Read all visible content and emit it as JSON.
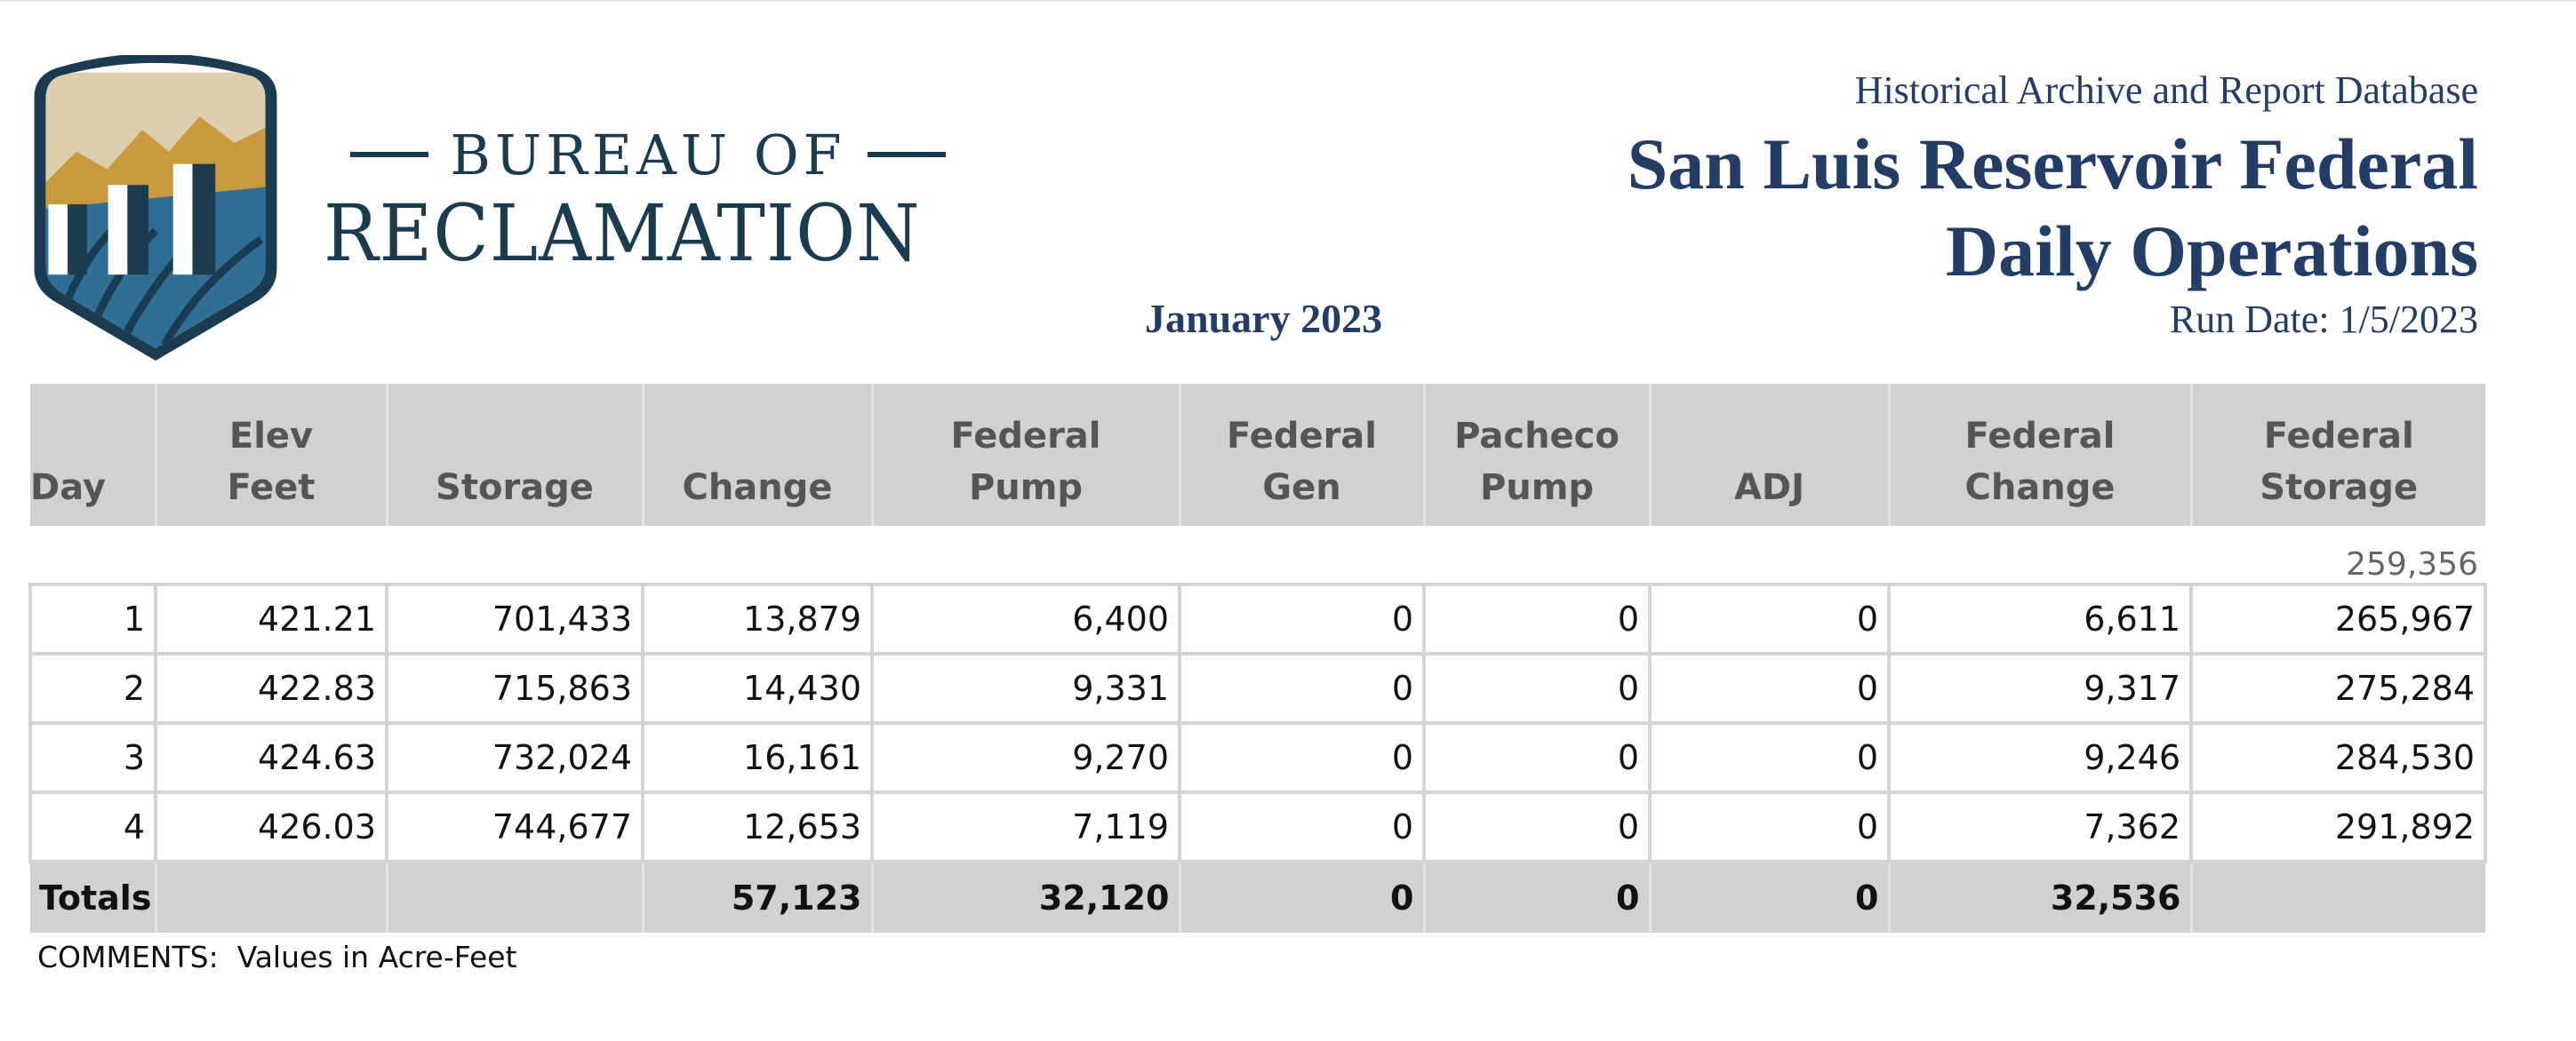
{
  "header": {
    "agency_line1": "BUREAU OF",
    "agency_line2": "RECLAMATION",
    "report_database": "Historical Archive and Report Database",
    "report_title": "San Luis Reservoir Federal\nDaily Operations",
    "run_date": "Run Date: 1/5/2023",
    "period": "January 2023"
  },
  "logo": {
    "icon": "reclamation-shield-icon",
    "colors": {
      "border": "#1b3b50",
      "sky": "#ddcfae",
      "mountains": "#c99a3d",
      "water": "#2f6f96",
      "pillars": "#1b3b50"
    }
  },
  "table": {
    "columns": [
      {
        "line1": "",
        "line2": "Day"
      },
      {
        "line1": "Elev",
        "line2": "Feet"
      },
      {
        "line1": "",
        "line2": "Storage"
      },
      {
        "line1": "",
        "line2": "Change"
      },
      {
        "line1": "Federal",
        "line2": "Pump"
      },
      {
        "line1": "Federal",
        "line2": "Gen"
      },
      {
        "line1": "Pacheco",
        "line2": "Pump"
      },
      {
        "line1": "",
        "line2": "ADJ"
      },
      {
        "line1": "Federal",
        "line2": "Change"
      },
      {
        "line1": "Federal",
        "line2": "Storage"
      }
    ],
    "starting_federal_storage": "259,356",
    "rows": [
      [
        "1",
        "421.21",
        "701,433",
        "13,879",
        "6,400",
        "0",
        "0",
        "0",
        "6,611",
        "265,967"
      ],
      [
        "2",
        "422.83",
        "715,863",
        "14,430",
        "9,331",
        "0",
        "0",
        "0",
        "9,317",
        "275,284"
      ],
      [
        "3",
        "424.63",
        "732,024",
        "16,161",
        "9,270",
        "0",
        "0",
        "0",
        "9,246",
        "284,530"
      ],
      [
        "4",
        "426.03",
        "744,677",
        "12,653",
        "7,119",
        "0",
        "0",
        "0",
        "7,362",
        "291,892"
      ]
    ],
    "totals": [
      "Totals",
      "",
      "",
      "57,123",
      "32,120",
      "0",
      "0",
      "0",
      "32,536",
      ""
    ],
    "colors": {
      "header_bg": "#d1d1d1",
      "grid": "#d4d4d4"
    }
  },
  "comments": "COMMENTS:  Values in Acre-Feet"
}
